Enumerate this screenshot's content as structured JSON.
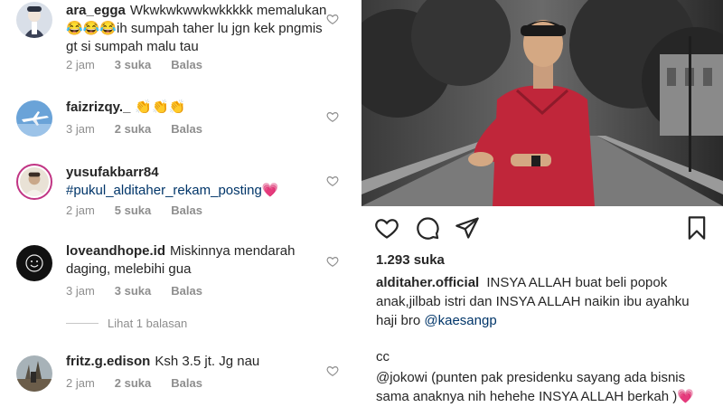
{
  "comments": [
    {
      "username": "ara_egga",
      "text": "Wkwkwkwwkwkkkkk memalukan😂😂😂ih sumpah taher lu jgn kek pngmis gt si sumpah malu tau",
      "time": "2 jam",
      "likes": "3 suka",
      "reply": "Balas"
    },
    {
      "username": "faizrizqy._",
      "text": "👏👏👏",
      "time": "3 jam",
      "likes": "2 suka",
      "reply": "Balas"
    },
    {
      "username": "yusufakbarr84",
      "text": "#pukul_alditaher_rekam_posting💗",
      "time": "2 jam",
      "likes": "5 suka",
      "reply": "Balas"
    },
    {
      "username": "loveandhope.id",
      "text": "Miskinnya mendarah daging, melebihi gua",
      "time": "3 jam",
      "likes": "3 suka",
      "reply": "Balas"
    },
    {
      "username": "fritz.g.edison",
      "text": "Ksh 3.5 jt. Jg nau",
      "time": "2 jam",
      "likes": "2 suka",
      "reply": "Balas"
    }
  ],
  "view_replies": "Lihat 1 balasan",
  "post": {
    "likes": "1.293 suka",
    "caption_user": "alditaher.official",
    "caption_text": "INSYA ALLAH buat beli popok anak,jilbab istri dan INSYA ALLAH naikin ibu ayahku haji bro",
    "caption_mention": "@kaesangp",
    "cc": "cc",
    "mention2": "@jokowi",
    "caption2": "(punten pak presidenku sayang ada bisnis sama anaknya nih hehehe INSYA ALLAH berkah )💗"
  },
  "icons": {
    "like": "heart-icon",
    "comment": "comment-icon",
    "share": "paper-plane-icon",
    "save": "bookmark-icon"
  },
  "colors": {
    "link": "#003569",
    "meta": "#8e8e8e",
    "shirt": "#c0263a"
  }
}
